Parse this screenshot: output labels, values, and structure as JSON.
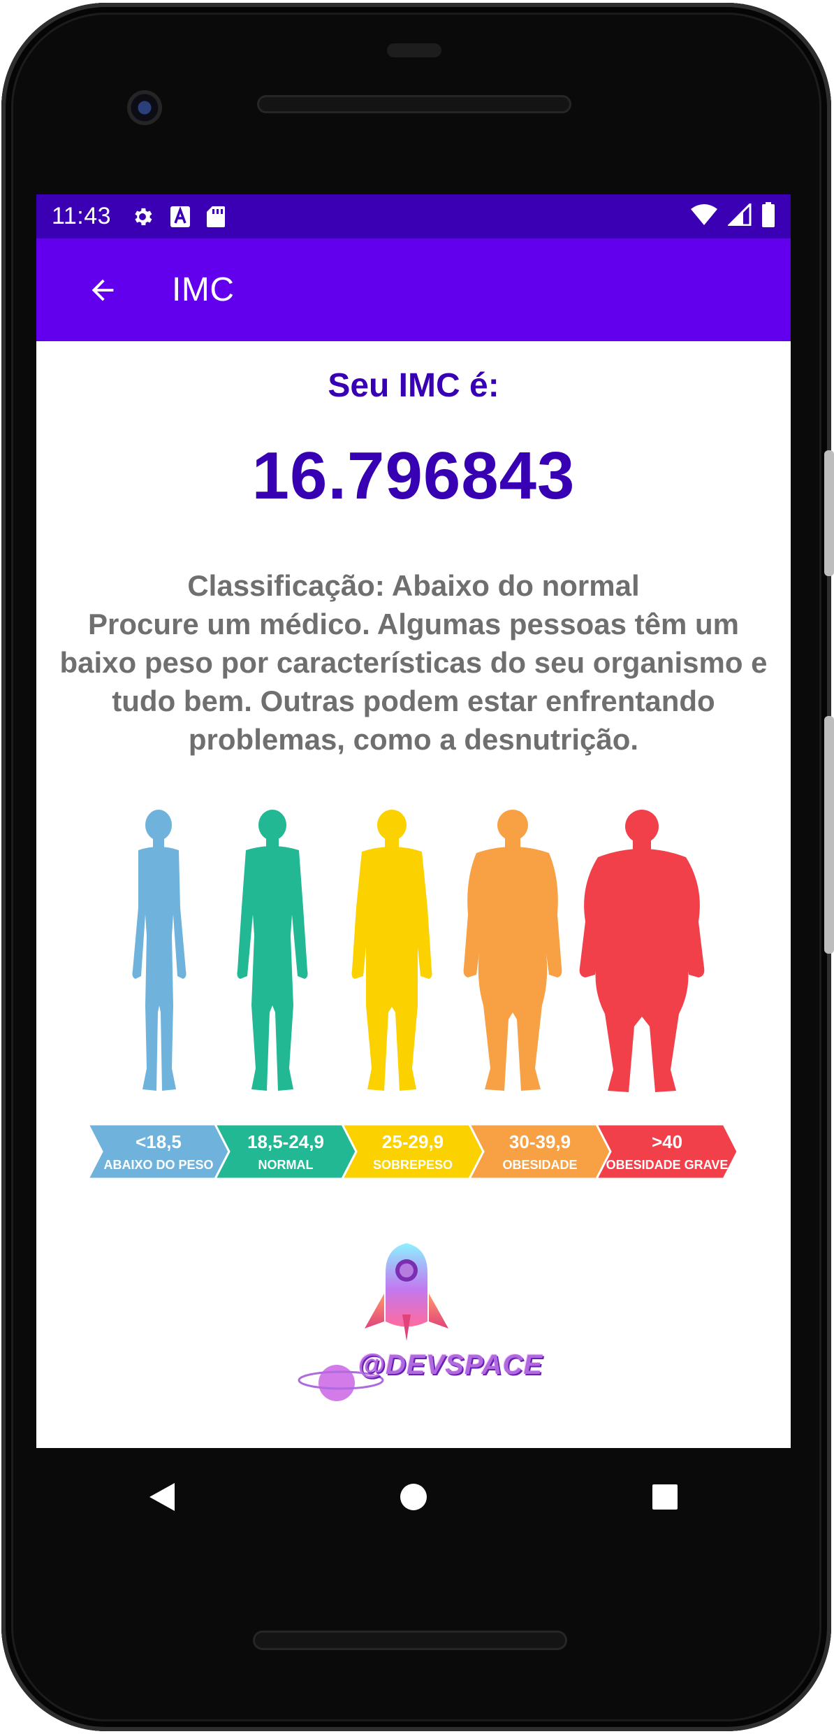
{
  "status_bar": {
    "time": "11:43",
    "left_icons": [
      "gear-icon",
      "text-a-icon",
      "sd-card-icon"
    ],
    "right_icons": [
      "wifi-icon",
      "signal-icon",
      "battery-icon"
    ],
    "color": "#3b00b3"
  },
  "app_bar": {
    "title": "IMC",
    "back_icon": "arrow-left-icon",
    "color": "#6200ee"
  },
  "result": {
    "label": "Seu IMC é:",
    "value": "16.796843",
    "classification": "Classificação: Abaixo do normal",
    "advice": "Procure um médico. Algumas pessoas têm um baixo peso por características do seu organismo e tudo bem. Outras podem estar enfrentando problemas, como a desnutrição.",
    "accent_color": "#3700b3",
    "text_color": "#6f6f6f"
  },
  "bmi_chart": {
    "segments": [
      {
        "range": "<18,5",
        "label": "ABAIXO DO PESO",
        "color": "#6fb3dc"
      },
      {
        "range": "18,5-24,9",
        "label": "NORMAL",
        "color": "#22b894"
      },
      {
        "range": "25-29,9",
        "label": "SOBREPESO",
        "color": "#fbd100"
      },
      {
        "range": "30-39,9",
        "label": "OBESIDADE",
        "color": "#f7a044"
      },
      {
        "range": ">40",
        "label": "OBESIDADE GRAVE",
        "color": "#f2404a"
      }
    ]
  },
  "logo": {
    "text": "@DEVSPACE"
  },
  "nav_bar": {
    "icons": [
      "nav-back-icon",
      "nav-home-icon",
      "nav-recents-icon"
    ]
  }
}
